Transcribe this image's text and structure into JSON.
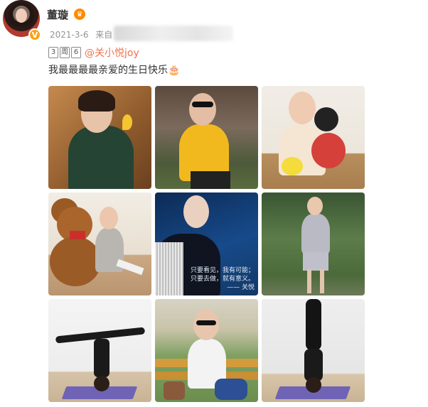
{
  "post": {
    "username": "董璇",
    "date": "2021-3-6",
    "source_prefix": "来自",
    "tag_digits": [
      "3",
      "周",
      "6"
    ],
    "mention": "@关小悦joy",
    "text": "我最最最最亲爱的生日快乐🎂"
  },
  "photos": [
    {
      "label": "photo-1"
    },
    {
      "label": "photo-2"
    },
    {
      "label": "photo-3"
    },
    {
      "label": "photo-4"
    },
    {
      "label": "photo-5",
      "caption_line1": "只要看见，我有可能；",
      "caption_line2": "只要去做，就有意义。",
      "caption_sign": "—— 关悦"
    },
    {
      "label": "photo-6"
    },
    {
      "label": "photo-7"
    },
    {
      "label": "photo-8"
    },
    {
      "label": "photo-9"
    }
  ],
  "colors": {
    "mention": "#eb7350",
    "verified_badge": "#f7a21b"
  }
}
